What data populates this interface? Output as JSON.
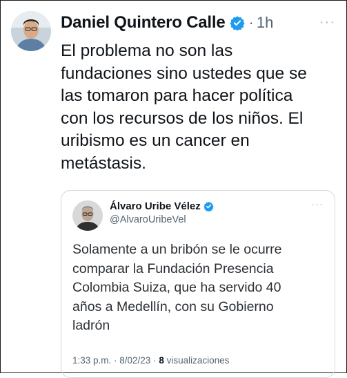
{
  "tweet": {
    "author_name": "Daniel Quintero Calle",
    "separator": "·",
    "time": "1h",
    "more": "···",
    "text": "El problema no son las\nfundaciones sino ustedes que se\nlas tomaron para hacer política\ncon los recursos de los niños. El\nuribismo es un cancer en\nmetástasis."
  },
  "quoted": {
    "author_name": "Álvaro Uribe Vélez",
    "handle": "@AlvaroUribeVel",
    "more": "···",
    "text": "Solamente a un bribón se le ocurre\ncomparar la Fundación Presencia\nColombia Suiza, que ha servido 40\naños a Medellín, con su Gobierno\nladrón",
    "timestamp": "1:33 p.m. · 8/02/23 · ",
    "views_count": "8",
    "views_label": " visualizaciones"
  },
  "colors": {
    "verified_blue": "#1d9bf0",
    "secondary_text": "#536471",
    "border": "#cfd9de"
  }
}
